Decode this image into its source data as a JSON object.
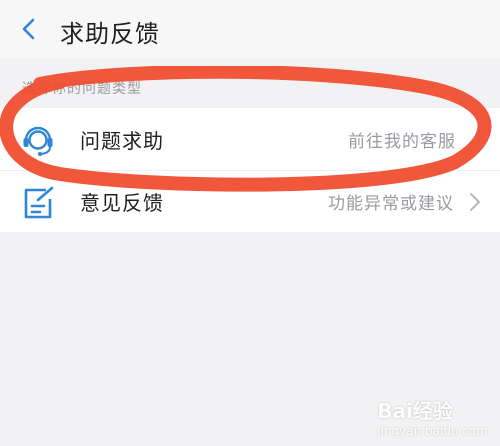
{
  "header": {
    "title": "求助反馈",
    "back_icon": "chevron-left-icon"
  },
  "section": {
    "label": "选择你的问题类型"
  },
  "items": [
    {
      "title": "问题求助",
      "subtitle": "前往我的客服",
      "icon": "headset-agent-icon",
      "chevron": false
    },
    {
      "title": "意见反馈",
      "subtitle": "功能异常或建议",
      "icon": "edit-note-icon",
      "chevron": true
    }
  ],
  "watermark": {
    "brand": "Bai经验",
    "url": "jingyan.baidu.com"
  },
  "colors": {
    "accent": "#2f86d6",
    "annotation": "#f04a2a",
    "background": "#f2f2f4"
  }
}
